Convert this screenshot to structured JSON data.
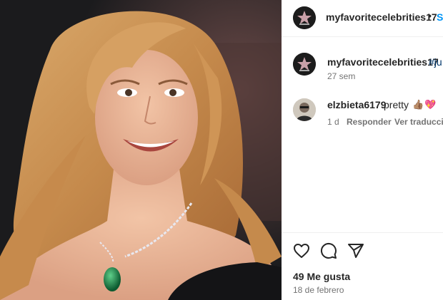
{
  "post": {
    "image_description": "photo",
    "author": "myfavoritecelebrities17",
    "separator": "•",
    "follow_label": "Se",
    "caption": {
      "username": "myfavoritecelebrities17",
      "text": "#ju",
      "time": "27 sem"
    },
    "comments": [
      {
        "username": "elzbieta6179",
        "text": "pretty",
        "emoji": [
          "👍🏽",
          "💖"
        ],
        "time": "1 d",
        "reply_label": "Responder",
        "translate_label": "Ver traducción"
      }
    ],
    "actions": {
      "like_icon": "heart-icon",
      "comment_icon": "comment-icon",
      "share_icon": "share-icon"
    },
    "likes": "49 Me gusta",
    "date": "18 de febrero"
  },
  "colors": {
    "link": "#0095f6",
    "hashtag": "#00376b",
    "muted": "#737373"
  }
}
